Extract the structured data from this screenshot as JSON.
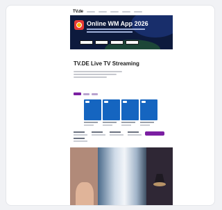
{
  "site": {
    "logo": "TV.de"
  },
  "hero": {
    "title": "Online WM App 2026"
  },
  "main": {
    "title": "TV.DE Live TV Streaming"
  },
  "colors": {
    "accent": "#7b1fa2",
    "hero_bg": "#0d1a3d",
    "channel_blue": "#1565c0"
  }
}
